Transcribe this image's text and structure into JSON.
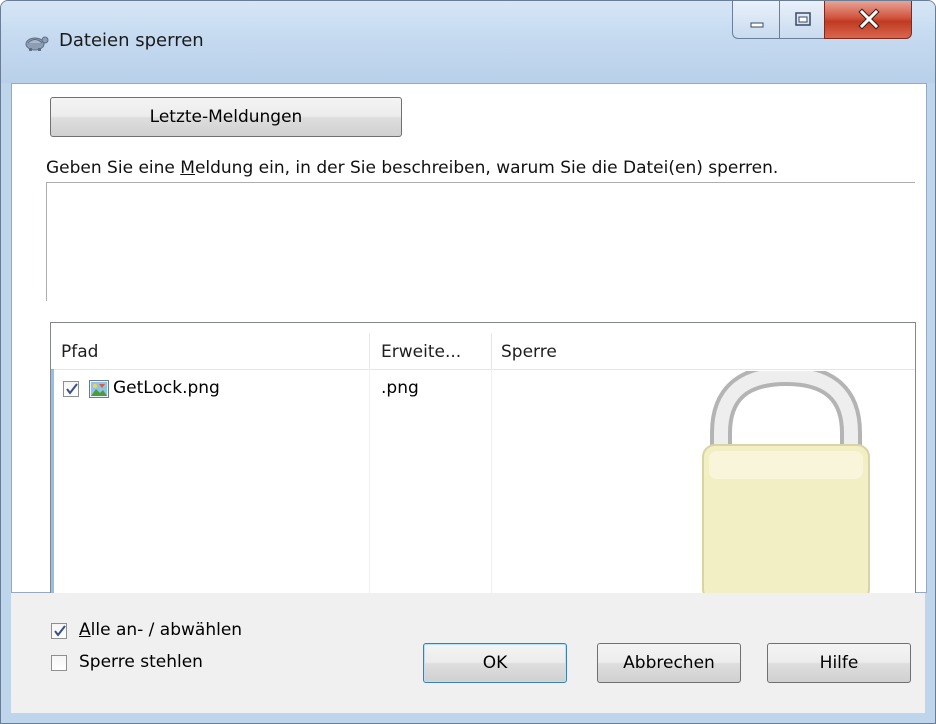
{
  "window": {
    "title": "Dateien sperren",
    "icon": "tortoise-icon",
    "controls": [
      "minimize-icon",
      "maximize-icon",
      "close-icon"
    ]
  },
  "recent_messages_button": "Letzte-Meldungen",
  "instruction": {
    "before": "Geben Sie eine ",
    "mnemonic": "M",
    "after": "eldung ein, in der Sie beschreiben, warum Sie die Datei(en) sperren."
  },
  "message_input": {
    "value": ""
  },
  "file_list": {
    "columns": [
      "Pfad",
      "Erweite...",
      "Sperre"
    ],
    "rows": [
      {
        "checked": true,
        "icon": "image-file-icon",
        "path": "GetLock.png",
        "extension": ".png",
        "lock": ""
      }
    ]
  },
  "select_all": {
    "mnemonic": "A",
    "rest": "lle an- / abwählen",
    "checked": true
  },
  "steal_lock": {
    "label": "Sperre stehlen",
    "checked": false
  },
  "buttons": {
    "ok": "OK",
    "cancel": "Abbrechen",
    "help": "Hilfe"
  },
  "colors": {
    "titlebar": "#c5daf0",
    "close_button": "#c9462d",
    "lock_body": "#f3efc4"
  }
}
